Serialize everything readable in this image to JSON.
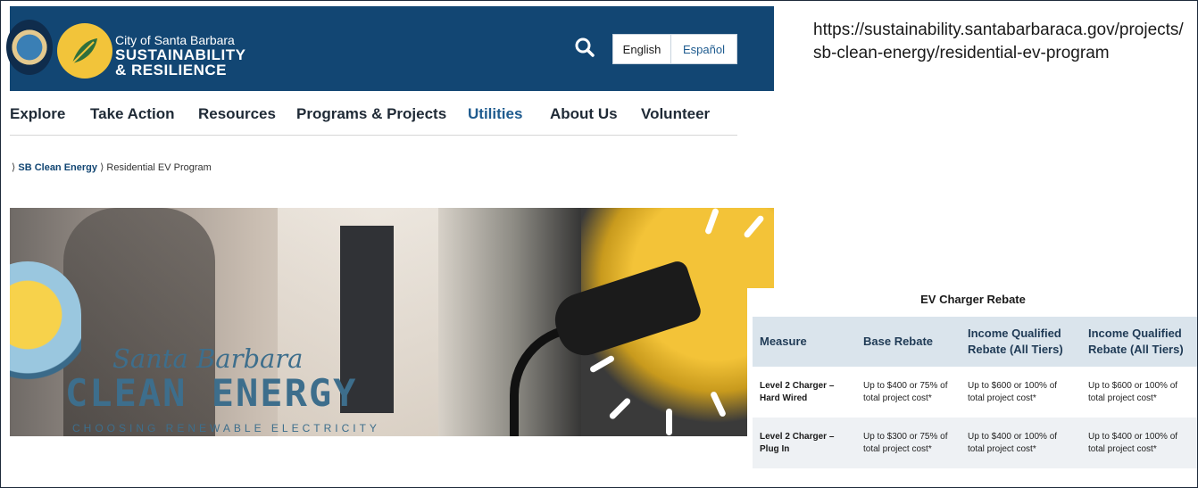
{
  "header": {
    "city": "City of Santa Barbara",
    "brand_line1": "SUSTAINABILITY",
    "brand_line2": "& RESILIENCE",
    "lang_english": "English",
    "lang_spanish": "Español"
  },
  "nav": {
    "items": [
      "Explore",
      "Take Action",
      "Resources",
      "Programs & Projects",
      "Utilities",
      "About Us",
      "Volunteer"
    ],
    "active": "Utilities"
  },
  "breadcrumb": {
    "sep": "⟩",
    "parent": "SB Clean Energy",
    "current": "Residential EV Program"
  },
  "hero": {
    "script": "Santa Barbara",
    "title": "CLEAN ENERGY",
    "tagline": "CHOOSING RENEWABLE ELECTRICITY"
  },
  "url": "https://sustainability.santabarbaraca.gov/projects/sb-clean-energy/residential-ev-program",
  "rebate_table": {
    "title": "EV Charger Rebate",
    "headers": [
      "Measure",
      "Base Rebate",
      "Income Qualified Rebate (All Tiers)",
      "Income Qualified Rebate (All Tiers)"
    ],
    "rows": [
      [
        "Level 2 Charger – Hard Wired",
        "Up to $400 or 75% of total project cost*",
        "Up to $600 or 100% of total project cost*",
        "Up to $600 or 100% of total project cost*"
      ],
      [
        "Level 2 Charger – Plug In",
        "Up to $300 or 75% of total project cost*",
        "Up to $400 or 100% of total project cost*",
        "Up to $400 or 100% of total project cost*"
      ]
    ]
  },
  "colors": {
    "header_bg": "#124673",
    "logo_yellow": "#f2c43a",
    "active_nav": "#1e5b8f",
    "table_header_bg": "#dae4ec"
  }
}
